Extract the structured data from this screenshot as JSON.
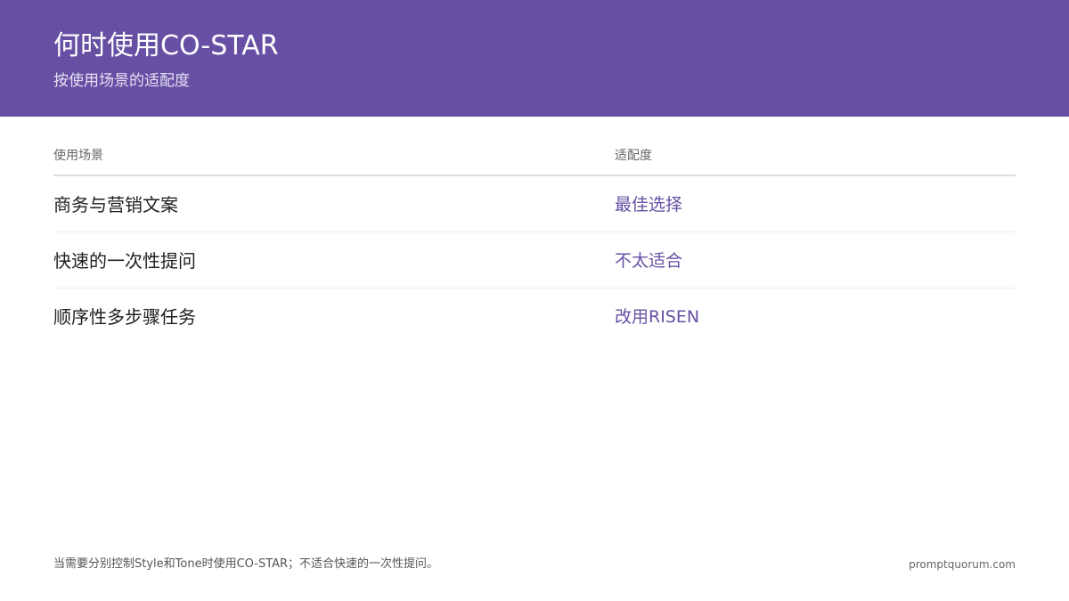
{
  "header": {
    "title": "何时使用CO-STAR",
    "subtitle": "按使用场景的适配度"
  },
  "table": {
    "columns": [
      "使用场景",
      "适配度"
    ],
    "rows": [
      {
        "scenario": "商务与营销文案",
        "fit": "最佳选择"
      },
      {
        "scenario": "快速的一次性提问",
        "fit": "不太适合"
      },
      {
        "scenario": "顺序性多步骤任务",
        "fit": "改用RISEN"
      }
    ]
  },
  "footer": {
    "note": "当需要分别控制Style和Tone时使用CO-STAR；不适合快速的一次性提问。",
    "brand": "promptquorum.com"
  },
  "colors": {
    "accent": "#6750a4",
    "header_text": "#ffffff"
  }
}
